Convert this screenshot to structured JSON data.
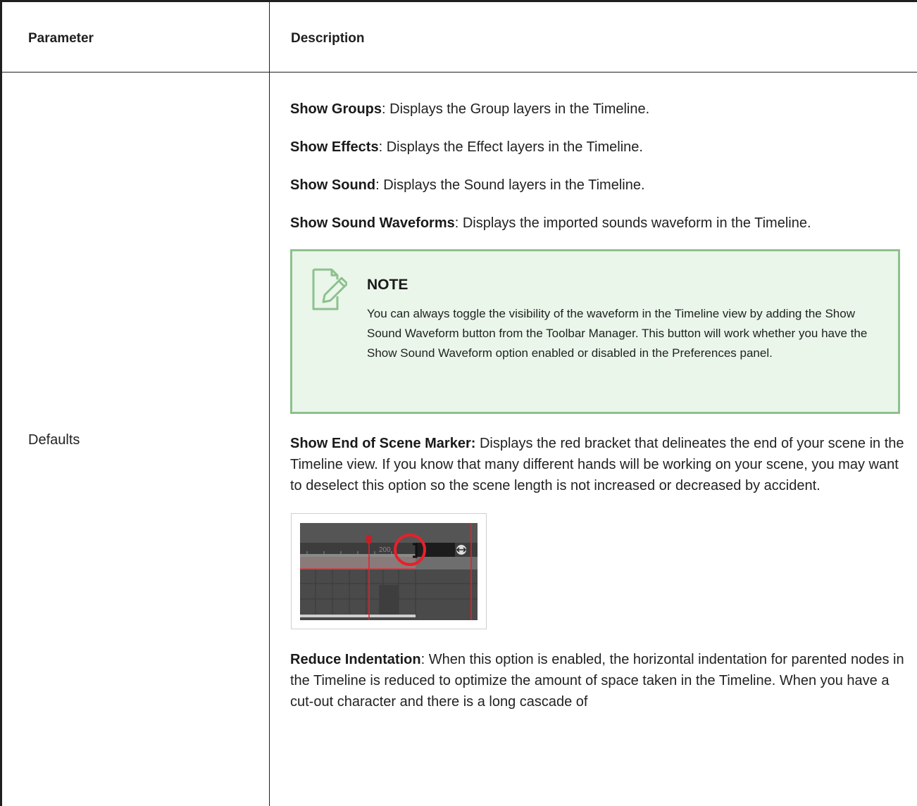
{
  "table": {
    "headers": {
      "parameter": "Parameter",
      "description": "Description"
    },
    "row": {
      "parameter": "Defaults",
      "items": [
        {
          "term": "Show Groups",
          "sep": ":",
          "text": " Displays the Group layers in the Timeline."
        },
        {
          "term": "Show Effects",
          "sep": ":",
          "text": " Displays the Effect layers in the Timeline."
        },
        {
          "term": "Show Sound",
          "sep": ":",
          "text": " Displays the Sound layers in the Timeline."
        },
        {
          "term": "Show Sound Waveforms",
          "sep": ":",
          "text": " Displays the imported sounds waveform in the Timeline."
        },
        {
          "term": "Show End of Scene Marker:",
          "sep": "",
          "text": " Displays the red bracket that delineates the end of your scene in the Timeline view. If you know that many different hands will be working on your scene, you may want to deselect this option so the scene length is not increased or decreased by accident."
        },
        {
          "term": "Reduce Indentation",
          "sep": ":",
          "text": " When this option is enabled, the horizontal indentation for parented nodes in the Timeline is reduced to optimize the amount of space taken in the Timeline. When you have a cut-out character and there is a long cascade of"
        }
      ],
      "note": {
        "title": "NOTE",
        "text": "You can always toggle the visibility of the waveform in the Timeline view by adding the Show Sound Waveform button from the Toolbar Manager. This button will work whether you have the Show Sound Waveform option enabled or disabled in the Preferences panel.",
        "icon": "note-pencil-icon",
        "accent": "#8ec08e",
        "background": "#eaf6ea"
      },
      "screenshot": {
        "frame_label": "200",
        "marker_color": "#e8202a"
      }
    }
  }
}
